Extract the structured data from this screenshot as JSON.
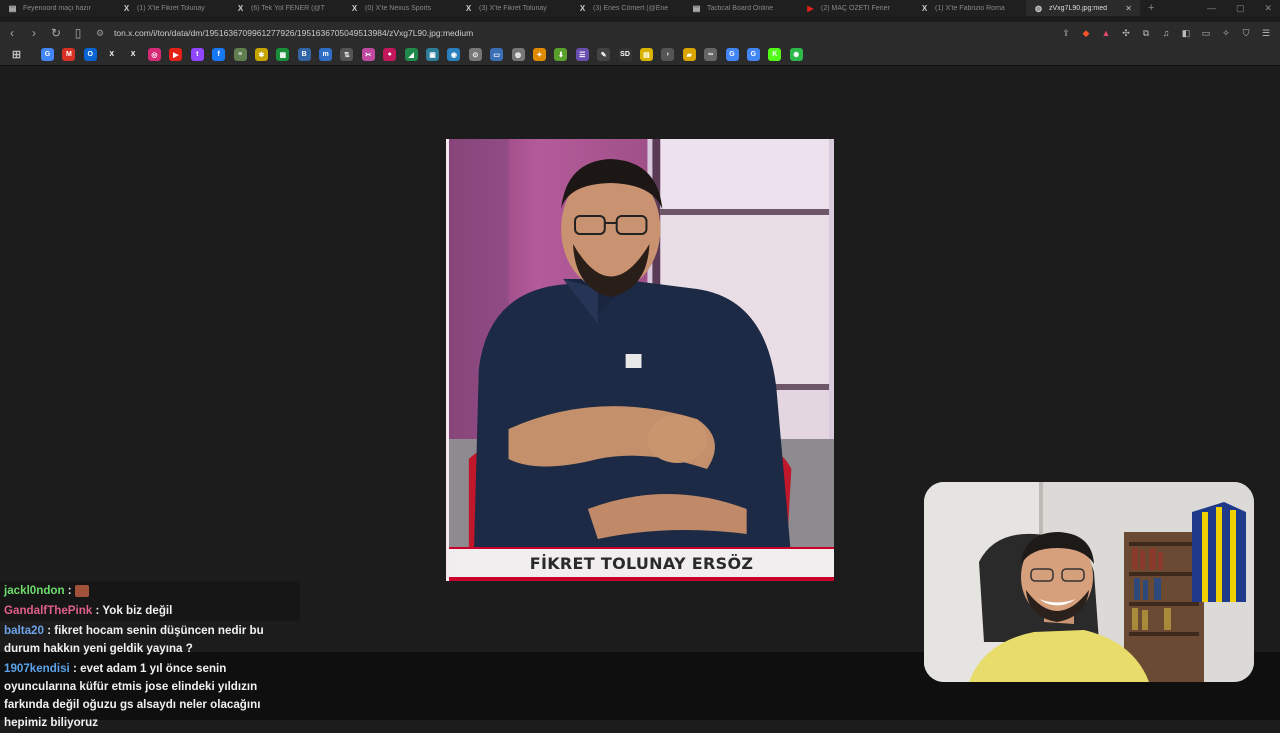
{
  "tabs": [
    {
      "title": "Feyenoord maçı hazır",
      "icon": "tab-generic-icon",
      "active": false
    },
    {
      "title": "(1) X'te Fikret Tolunay",
      "icon": "x-logo-icon",
      "active": false
    },
    {
      "title": "(6) Tek Yol FENER (@T",
      "icon": "x-logo-icon",
      "active": false
    },
    {
      "title": "(0) X'te Nexus Sports",
      "icon": "x-logo-icon",
      "active": false
    },
    {
      "title": "(3) X'te Fikret Tolunay",
      "icon": "x-logo-icon",
      "active": false
    },
    {
      "title": "(3) Enes Cömert (@Ene",
      "icon": "x-logo-icon",
      "active": false
    },
    {
      "title": "Tactical Board Online",
      "icon": "tab-generic-icon",
      "active": false
    },
    {
      "title": "(2) MAÇ ÖZETİ Fener",
      "icon": "youtube-icon",
      "active": false
    },
    {
      "title": "(1) X'te Fabrizio Roma",
      "icon": "x-logo-icon",
      "active": false
    },
    {
      "title": "zVxg7L90.jpg:med",
      "icon": "globe-icon",
      "active": true
    }
  ],
  "address_bar": {
    "url": "ton.x.com/i/ton/data/dm/1951636709961277926/1951636705049513984/zVxg7L90.jpg:medium"
  },
  "bookmarks": [
    {
      "icon": "google-icon",
      "glyph": "G",
      "color": "#4285f4"
    },
    {
      "icon": "gmail-icon",
      "glyph": "M",
      "color": "#d93025"
    },
    {
      "icon": "outlook-icon",
      "glyph": "O",
      "color": "#0a64d2"
    },
    {
      "icon": "x-logo-icon",
      "glyph": "X",
      "color": "#2b2b2b"
    },
    {
      "icon": "x-logo-icon",
      "glyph": "X",
      "color": "#2b2b2b"
    },
    {
      "icon": "instagram-icon",
      "glyph": "◎",
      "color": "#d62976"
    },
    {
      "icon": "youtube-icon",
      "glyph": "▶",
      "color": "#e62117"
    },
    {
      "icon": "twitch-icon",
      "glyph": "t",
      "color": "#9146ff"
    },
    {
      "icon": "facebook-icon",
      "glyph": "f",
      "color": "#1877f2"
    },
    {
      "icon": "sheet-icon",
      "glyph": "≡",
      "color": "#5f7d4f"
    },
    {
      "icon": "gear-icon",
      "glyph": "✱",
      "color": "#c8a400"
    },
    {
      "icon": "sheets-icon",
      "glyph": "▦",
      "color": "#1a8f3a"
    },
    {
      "icon": "bookmark-icon",
      "glyph": "B",
      "color": "#3465a4"
    },
    {
      "icon": "m-icon",
      "glyph": "m",
      "color": "#2f6ec7"
    },
    {
      "icon": "sort-icon",
      "glyph": "⇅",
      "color": "#555"
    },
    {
      "icon": "scissors-icon",
      "glyph": "✂",
      "color": "#c04aa0"
    },
    {
      "icon": "circle-icon",
      "glyph": "●",
      "color": "#c2185b"
    },
    {
      "icon": "chat-icon",
      "glyph": "◢",
      "color": "#1f8a4c"
    },
    {
      "icon": "image-icon",
      "glyph": "▣",
      "color": "#2e7d9a"
    },
    {
      "icon": "target-icon",
      "glyph": "◉",
      "color": "#2a7fbf"
    },
    {
      "icon": "search-icon",
      "glyph": "⊙",
      "color": "#777"
    },
    {
      "icon": "window-icon",
      "glyph": "▭",
      "color": "#3b6fb6"
    },
    {
      "icon": "globe-icon",
      "glyph": "◍",
      "color": "#777"
    },
    {
      "icon": "shapes-icon",
      "glyph": "✦",
      "color": "#e08a00"
    },
    {
      "icon": "download-icon",
      "glyph": "⬇",
      "color": "#5aa02c"
    },
    {
      "icon": "list-icon",
      "glyph": "☰",
      "color": "#6a4fb0"
    },
    {
      "icon": "paint-icon",
      "glyph": "✎",
      "color": "#444"
    },
    {
      "icon": "sd-icon",
      "glyph": "SD",
      "color": "#333"
    },
    {
      "icon": "ticket-icon",
      "glyph": "▤",
      "color": "#d9b300"
    },
    {
      "icon": "arrow-icon",
      "glyph": "›",
      "color": "#555"
    },
    {
      "icon": "folder-icon",
      "glyph": "▰",
      "color": "#d9a400"
    },
    {
      "icon": "link-icon",
      "glyph": "∞",
      "color": "#666"
    },
    {
      "icon": "google-icon",
      "glyph": "G",
      "color": "#4285f4"
    },
    {
      "icon": "google-icon",
      "glyph": "G",
      "color": "#4285f4"
    },
    {
      "icon": "kick-icon",
      "glyph": "K",
      "color": "#53fc18"
    },
    {
      "icon": "settings-icon",
      "glyph": "✺",
      "color": "#2fb84a"
    }
  ],
  "image": {
    "caption": "FİKRET TOLUNAY ERSÖZ",
    "accent_color": "#c9002b"
  },
  "chat": [
    {
      "user": "jackl0ndon",
      "color": "#6ddc6d",
      "message": "",
      "emote": "emote-icon",
      "boxed": true
    },
    {
      "user": "GandalfThePink",
      "color": "#e05f8c",
      "message": "Yok biz değil",
      "boxed": true
    },
    {
      "user": "balta20",
      "color": "#6ea2e8",
      "message": "fikret hocam senin düşüncen nedir bu durum hakkın yeni geldik yayına ?",
      "boxed": false
    },
    {
      "user": "1907kendisi",
      "color": "#5aa3e8",
      "message": "evet adam 1 yıl önce senin oyuncularına küfür etmis jose elindeki yıldızın farkında değil oğuzu gs alsaydı neler olacağını hepimiz biliyoruz",
      "boxed": false
    }
  ]
}
